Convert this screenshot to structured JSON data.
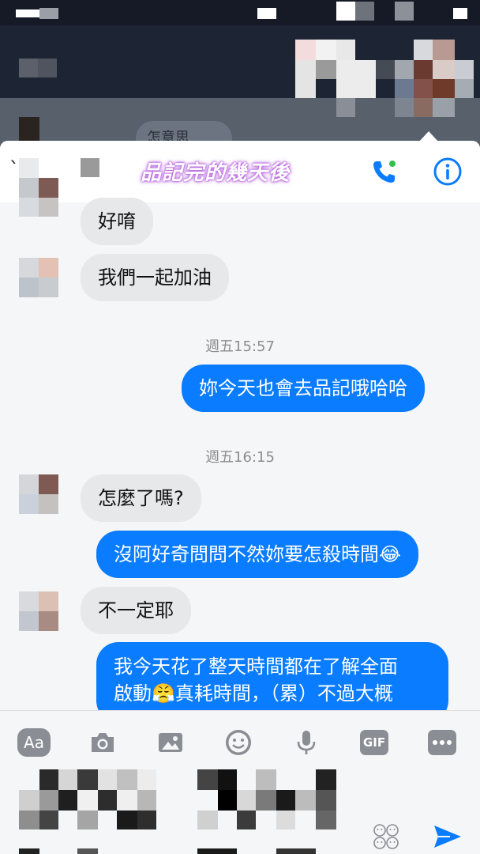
{
  "background_app": {
    "chip_text": "怎意思"
  },
  "header": {
    "title": "品記完的幾天後"
  },
  "messages": [
    {
      "sender": "them",
      "text": "好唷"
    },
    {
      "sender": "them",
      "text": "我們一起加油"
    },
    {
      "timestamp": "週五15:57"
    },
    {
      "sender": "me",
      "text": "妳今天也會去品記哦哈哈"
    },
    {
      "timestamp": "週五16:15"
    },
    {
      "sender": "them",
      "text": "怎麼了嗎?"
    },
    {
      "sender": "me",
      "text": "沒阿好奇問問不然妳要怎殺時間😂"
    },
    {
      "sender": "them",
      "text": "不一定耶"
    },
    {
      "sender": "me",
      "lines": [
        "我今天花了整天時間都在了解全面",
        "啟動😤真耗時間，（累）不過大概"
      ]
    }
  ],
  "composer": {
    "aa_label": "Aa",
    "gif_label": "GIF"
  },
  "colors": {
    "outgoing_bubble": "#0a7cff",
    "incoming_bubble": "#e7e8ea",
    "accent": "#0a7cff",
    "card_background": "#f5f6f7"
  },
  "icons": [
    "back-icon",
    "phone-icon",
    "info-icon",
    "camera-icon",
    "image-icon",
    "smiley-icon",
    "microphone-icon",
    "more-icon",
    "emoji-grid-icon",
    "send-icon"
  ]
}
